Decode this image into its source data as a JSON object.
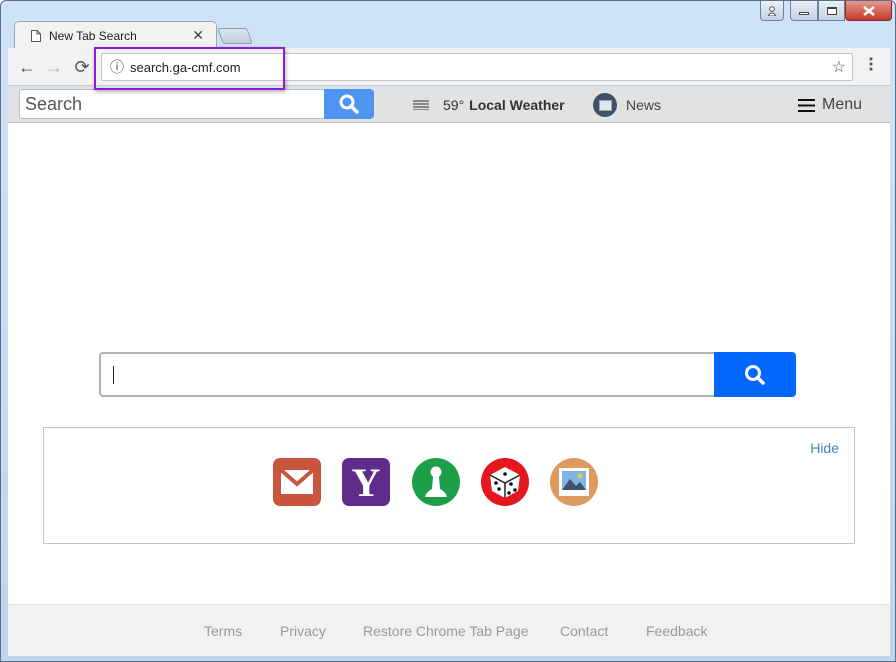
{
  "window": {
    "controls": {
      "user": "user-icon",
      "minimize": "minimize-icon",
      "maximize": "maximize-icon",
      "close": "close-icon"
    }
  },
  "tabs": [
    {
      "title": "New Tab Search",
      "icon": "page-icon",
      "active": true
    }
  ],
  "toolbar": {
    "url": "search.ga-cmf.com",
    "back": "←",
    "forward": "→",
    "reload": "⟳",
    "info": "ⓘ",
    "star": "☆",
    "menu": "⋮"
  },
  "topbar": {
    "search_placeholder": "Search",
    "weather_temp": "59°",
    "weather_label": "Local Weather",
    "news_label": "News",
    "menu_label": "Menu"
  },
  "main": {
    "search_value": "",
    "search_button_color": "#0366ff"
  },
  "shortcuts": {
    "hide_label": "Hide",
    "items": [
      {
        "name": "Mail",
        "icon": "mail-icon",
        "color": "#c9553e"
      },
      {
        "name": "Yahoo",
        "icon": "yahoo-icon",
        "glyph": "Y",
        "color": "#5f2c8c"
      },
      {
        "name": "Games",
        "icon": "chess-pawn-icon",
        "color": "#1f9e4a"
      },
      {
        "name": "Dice",
        "icon": "dice-icon",
        "color": "#e4171e"
      },
      {
        "name": "Photos",
        "icon": "photo-icon",
        "color": "#de9a5f"
      }
    ]
  },
  "footer": {
    "links": [
      "Terms",
      "Privacy",
      "Restore Chrome Tab Page",
      "Contact",
      "Feedback"
    ]
  }
}
